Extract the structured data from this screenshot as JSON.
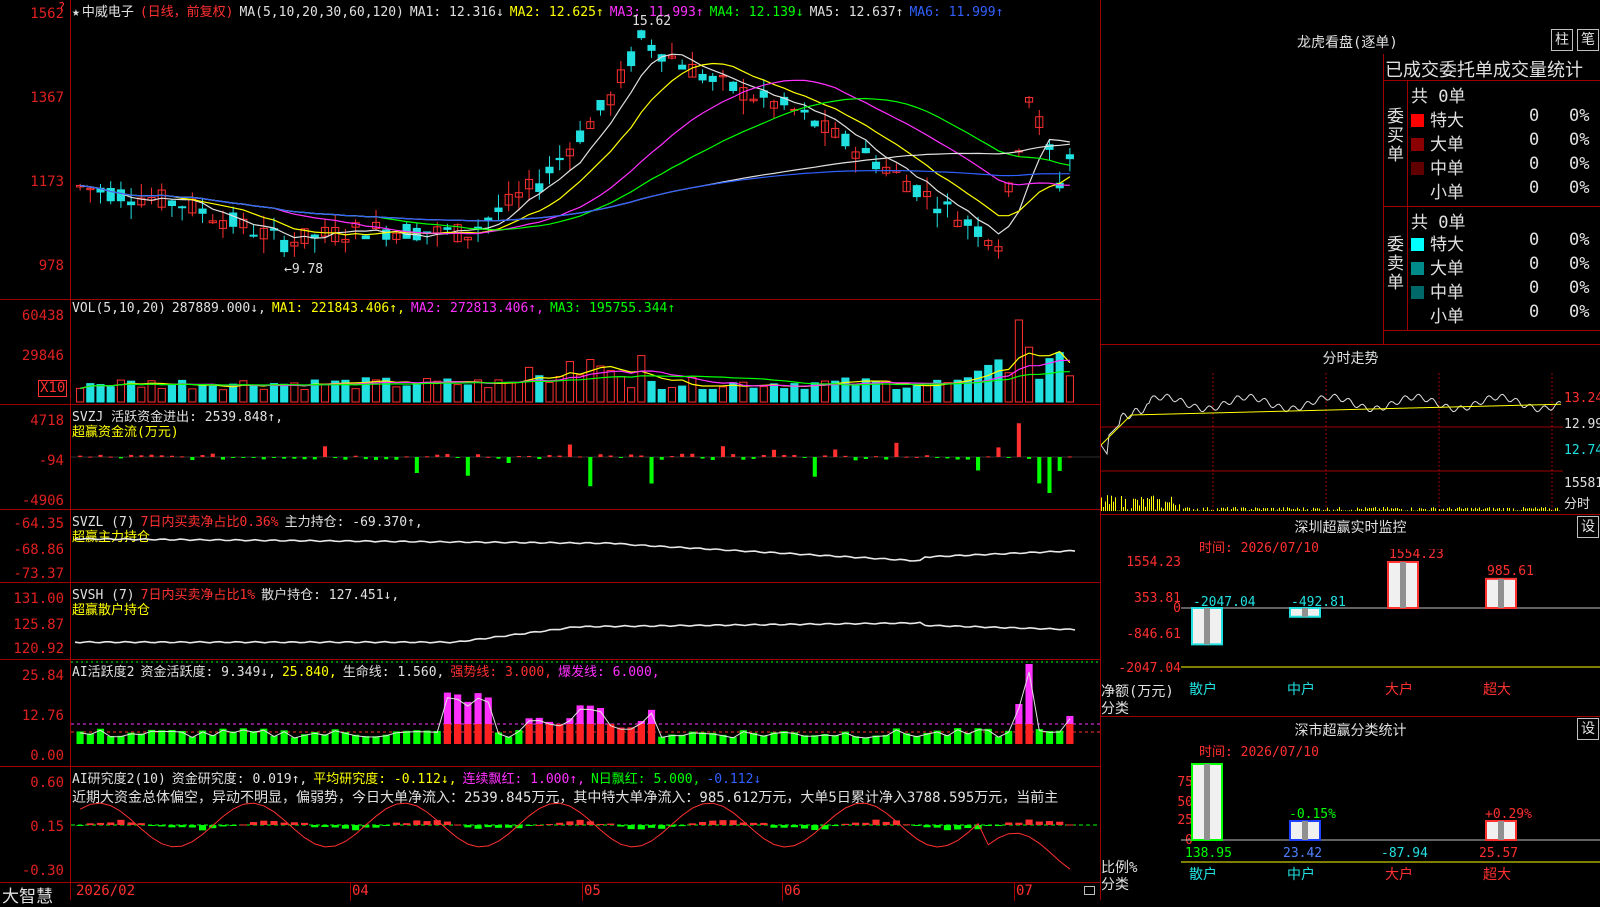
{
  "app": {
    "brand": "大智慧"
  },
  "main_chart": {
    "title_star": "★",
    "stock_name": "中威电子",
    "period": "(日线，前复权)",
    "ma_params": "MA(5,10,20,30,60,120)",
    "ma": [
      {
        "label": "MA1:",
        "value": "12.316↓",
        "color": "#e0e0e0"
      },
      {
        "label": "MA2:",
        "value": "12.625↑",
        "color": "#ffff00"
      },
      {
        "label": "MA3:",
        "value": "11.993↑",
        "color": "#ff30ff"
      },
      {
        "label": "MA4:",
        "value": "12.139↓",
        "color": "#00ff00"
      },
      {
        "label": "MA5:",
        "value": "12.637↑",
        "color": "#e0e0e0"
      },
      {
        "label": "MA6:",
        "value": "11.999↑",
        "color": "#3060ff"
      }
    ],
    "y_labels": [
      "1562",
      "1367",
      "1173",
      "978"
    ],
    "high_label": "15.62",
    "low_label": "9.78",
    "corner_mark": "?"
  },
  "vol_panel": {
    "legend": [
      {
        "text": "VOL(5,10,20)",
        "color": "#e0e0e0"
      },
      {
        "text": "287889.000↓,",
        "color": "#e0e0e0"
      },
      {
        "text": "MA1: 221843.406↑,",
        "color": "#ffff00"
      },
      {
        "text": "MA2: 272813.406↑,",
        "color": "#ff30ff"
      },
      {
        "text": "MA3: 195755.344↑",
        "color": "#00ff00"
      }
    ],
    "y_labels": [
      "60438",
      "29846",
      "X10"
    ]
  },
  "svzj_panel": {
    "legend1": "SVZJ  活跃资金进出: 2539.848↑,",
    "legend2": "超赢资金流(万元)",
    "y_labels": [
      "4718",
      "-94",
      "-4906"
    ]
  },
  "svzl_panel": {
    "legend_a": "SVZL (7)",
    "legend_b": "7日内买卖净占比0.36%",
    "legend_c": "主力持仓: -69.370↑,",
    "legend2": "超赢主力持仓",
    "y_labels": [
      "-64.35",
      "-68.86",
      "-73.37"
    ]
  },
  "svsh_panel": {
    "legend_a": "SVSH (7)",
    "legend_b": "7日内买卖净占比1%",
    "legend_c": "散户持仓: 127.451↓,",
    "legend2": "超赢散户持仓",
    "y_labels": [
      "131.00",
      "125.87",
      "120.92"
    ]
  },
  "ai_active_panel": {
    "legend": [
      {
        "text": "AI活跃度2",
        "color": "#e0e0e0"
      },
      {
        "text": "资金活跃度: 9.349↓,",
        "color": "#e0e0e0"
      },
      {
        "text": "25.840,",
        "color": "#ffff00"
      },
      {
        "text": "生命线: 1.560,",
        "color": "#e0e0e0"
      },
      {
        "text": "强势线: 3.000,",
        "color": "#ff3030"
      },
      {
        "text": "爆发线: 6.000,",
        "color": "#ff30ff"
      }
    ],
    "y_labels": [
      "25.84",
      "12.76",
      "0.00"
    ]
  },
  "ai_research_panel": {
    "legend": [
      {
        "text": "AI研究度2(10)",
        "color": "#e0e0e0"
      },
      {
        "text": "资金研究度: 0.019↑,",
        "color": "#e0e0e0"
      },
      {
        "text": "平均研究度: -0.112↓,",
        "color": "#ffff00"
      },
      {
        "text": "连续飘红: 1.000↑,",
        "color": "#ff30ff"
      },
      {
        "text": "N日飘红: 5.000,",
        "color": "#00ff00"
      },
      {
        "text": "-0.112↓",
        "color": "#3060ff"
      }
    ],
    "commentary": "近期大资金总体偏空，异动不明显，偏弱势，今日大单净流入：2539.845万元，其中特大单净流入：985.612万元，大单5日累计净入3788.595万元，当前主",
    "y_labels": [
      "0.60",
      "0.15",
      "-0.30"
    ]
  },
  "x_axis": {
    "labels": [
      "2026/02",
      "04",
      "05",
      "06",
      "07"
    ]
  },
  "dragon_tiger": {
    "title": "龙虎看盘(逐单)",
    "btn1": "柱",
    "btn2": "笔",
    "header": "已成交委托单成交量统计",
    "buy_label": "委买单",
    "sell_label": "委卖单",
    "buy_total": "共 0单",
    "sell_total": "共 0单",
    "buy_rows": [
      {
        "name": "特大",
        "count": "0",
        "pct": "0%",
        "color": "#ff0000"
      },
      {
        "name": "大单",
        "count": "0",
        "pct": "0%",
        "color": "#8b0000"
      },
      {
        "name": "中单",
        "count": "0",
        "pct": "0%",
        "color": "#600000"
      },
      {
        "name": "小单",
        "count": "0",
        "pct": "0%",
        "color": "#000000"
      }
    ],
    "sell_rows": [
      {
        "name": "特大",
        "count": "0",
        "pct": "0%",
        "color": "#00ffff"
      },
      {
        "name": "大单",
        "count": "0",
        "pct": "0%",
        "color": "#008b8b"
      },
      {
        "name": "中单",
        "count": "0",
        "pct": "0%",
        "color": "#006868"
      },
      {
        "name": "小单",
        "count": "0",
        "pct": "0%",
        "color": "#000000"
      }
    ]
  },
  "intraday": {
    "title": "分时走势",
    "labels": [
      "13.24",
      "12.99",
      "12.74",
      "15581",
      "分时"
    ]
  },
  "sz_realtime": {
    "title": "深圳超赢实时监控",
    "btn": "设",
    "time": "时间: 2026/07/10",
    "y_labels": [
      "1554.23",
      "353.81",
      "0",
      "-846.61",
      "-2047.04"
    ],
    "axis_label1": "净额(万元)",
    "axis_label2": "分类",
    "categories": [
      "散户",
      "中户",
      "大户",
      "超大"
    ],
    "values": [
      -2047.04,
      -492.81,
      1554.23,
      985.61
    ],
    "value_labels": [
      "-2047.04",
      "-492.81",
      "1554.23",
      "985.61"
    ]
  },
  "sz_classify": {
    "title": "深市超赢分类统计",
    "btn": "设",
    "time": "时间: 2026/07/10",
    "y_labels": [
      "75",
      "50",
      "25",
      "0"
    ],
    "axis_label1": "比例%",
    "axis_label2": "分类",
    "categories": [
      "散户",
      "中户",
      "大户",
      "超大"
    ],
    "pct_labels": [
      "",
      "-0.15%",
      "",
      "+0.29%"
    ],
    "bottom_values": [
      "138.95",
      "23.42",
      "-87.94",
      "25.57"
    ],
    "bar_pcts": [
      100,
      25,
      0,
      25
    ]
  }
}
